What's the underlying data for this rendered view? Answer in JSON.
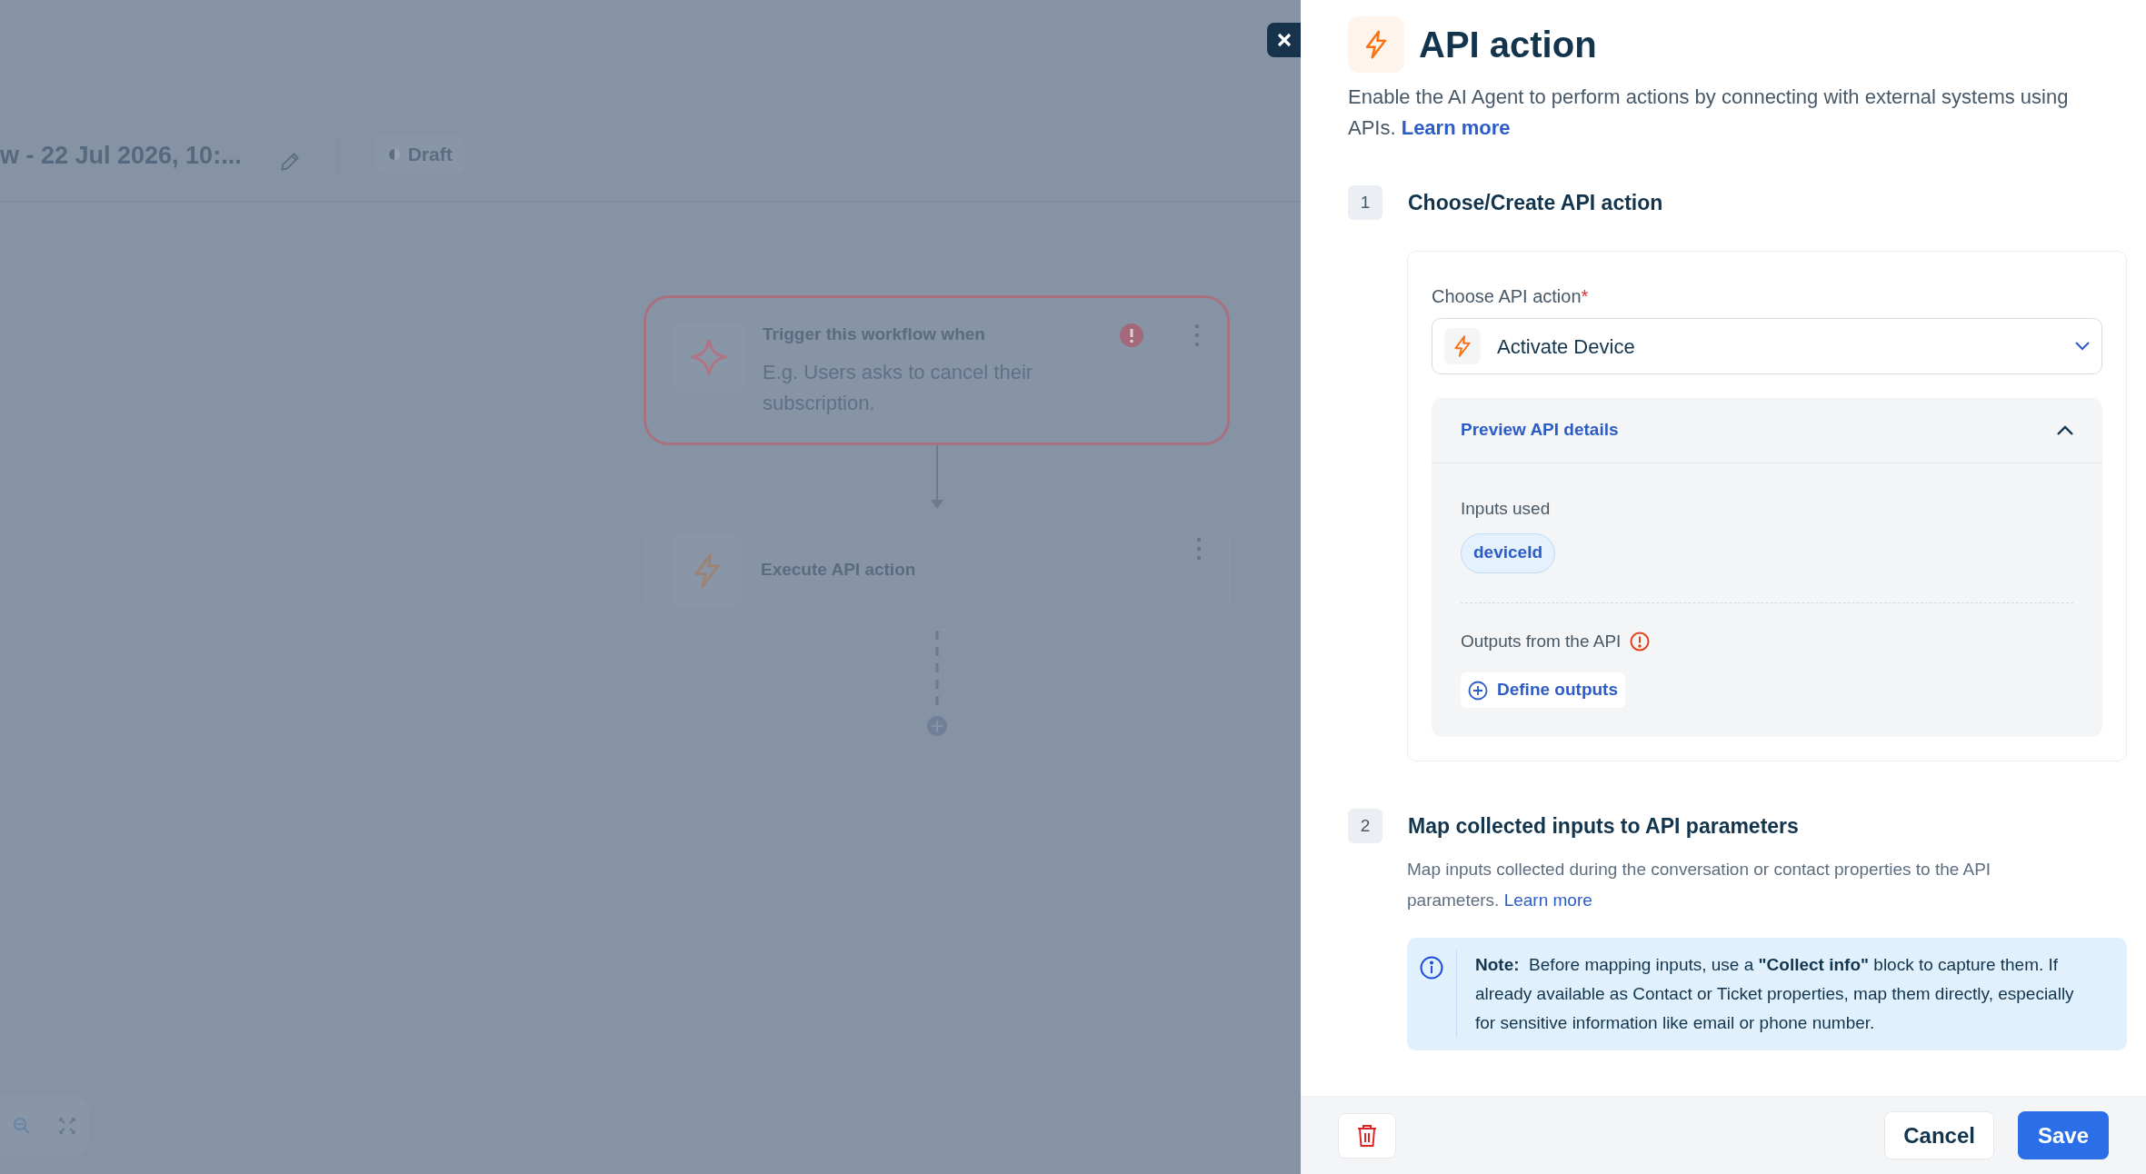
{
  "canvas": {
    "flow_title": "w - 22 Jul 2026, 10:...",
    "status_badge": "Draft",
    "nodes": [
      {
        "kind": "trigger",
        "title": "Trigger this workflow when",
        "placeholder": "E.g. Users asks to cancel their subscription.",
        "error": true
      },
      {
        "kind": "action",
        "title": "Execute API action",
        "error": false
      }
    ]
  },
  "panel": {
    "title": "API action",
    "description": "Enable the AI Agent to perform actions by connecting with external systems using APIs.",
    "description_link": "Learn more",
    "step_1": {
      "number": "1",
      "title": "Choose/Create API action",
      "field_label": "Choose API action",
      "required_mark": "*",
      "selected_value": "Activate Device",
      "preview": {
        "title": "Preview API details",
        "expanded": true,
        "inputs_label": "Inputs used",
        "inputs": [
          "deviceId"
        ],
        "outputs_label": "Outputs from the API",
        "outputs_warning": true,
        "define_outputs": "Define outputs"
      }
    },
    "step_2": {
      "number": "2",
      "title": "Map collected inputs to API parameters",
      "description": "Map inputs collected during the conversation or contact properties to the API parameters.",
      "link": "Learn more",
      "note": "**Note:**  Before mapping inputs, use a **\"Collect info\"** block to capture them. If already available as Contact or Ticket properties, map them directly, especially for sensitive information like email or phone number."
    }
  },
  "footer": {
    "cancel": "Cancel",
    "save": "Save"
  }
}
